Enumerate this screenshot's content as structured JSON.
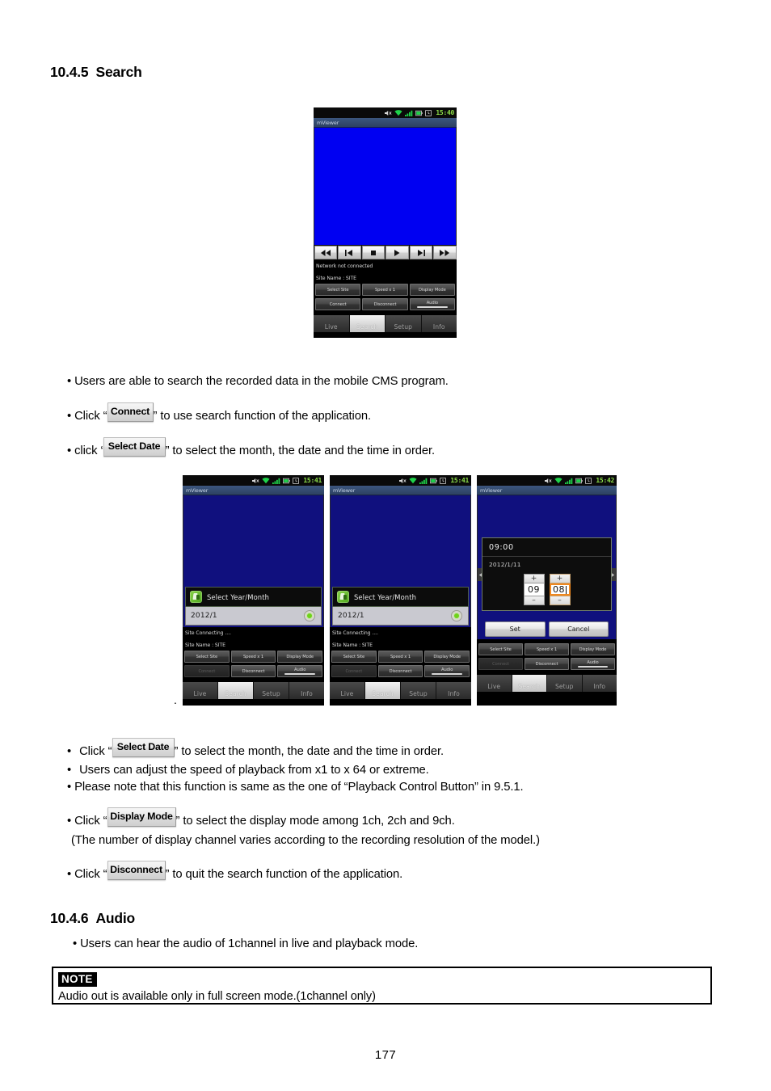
{
  "document": {
    "page_number": "177",
    "sections": [
      {
        "number": "10.4.5",
        "title": "Search"
      },
      {
        "number": "10.4.6",
        "title": "Audio"
      }
    ]
  },
  "search_section": {
    "bullets": {
      "b1": "Users are able to search the recorded data in the mobile CMS program.",
      "b2_pre": "Click “",
      "b2_btn": "Connect",
      "b2_post": "” to use search function of the application.",
      "b3_pre": "click ‘",
      "b3_btn": "Select Date",
      "b3_post": "” to select the month, the date and the time in order.",
      "b4_pre": "Click “",
      "b4_btn": "Select Date",
      "b4_post": "” to select the month, the date and the time in order.",
      "b5": "Users can adjust the speed of playback from x1 to x 64 or extreme.",
      "b6": "Please note that this function is same as the one of “Playback Control Button” in 9.5.1.",
      "b7_pre": "Click “",
      "b7_btn": "Display Mode",
      "b7_post": "” to select the display mode among 1ch, 2ch and 9ch.",
      "b8": "(The number of display channel varies according to the recording resolution of the model.)",
      "b9_pre": "Click “",
      "b9_btn": "Disconnect",
      "b9_post": "” to quit the search function of the application."
    }
  },
  "audio_section": {
    "bullet": "Users can hear the audio of 1channel in live and playback mode.",
    "note_tag": "NOTE",
    "note_text": "Audio out is available only in full screen mode.(1channel only)"
  },
  "phones": {
    "phone1": {
      "status_time": "15:40",
      "app_title": "mViewer",
      "transport_buttons": [
        "rewind-icon",
        "step-back-icon",
        "stop-icon",
        "play-icon",
        "step-forward-icon",
        "fast-forward-icon"
      ],
      "status_line1": "Network not connected",
      "status_line2": "Site Name : SITE",
      "controls_row1": [
        "Select Site",
        "Speed x 1",
        "Display Mode"
      ],
      "controls_row2": [
        "Connect",
        "Disconnect",
        "Audio"
      ],
      "tabs": [
        "Live",
        "Search",
        "Setup",
        "Info"
      ],
      "active_tab": "Search"
    },
    "phone2": {
      "status_time": "15:41",
      "app_title": "mViewer",
      "dialog_title": "Select Year/Month",
      "dialog_value": "2012/1",
      "status_line1": "Site Connecting ....",
      "status_line2": "Site Name : SITE",
      "controls_row1": [
        "Select Site",
        "Speed x 1",
        "Display Mode"
      ],
      "controls_row2": [
        "Connect",
        "Disconnect",
        "Audio"
      ],
      "tabs": [
        "Live",
        "Search",
        "Setup",
        "Info"
      ],
      "active_tab": "Search"
    },
    "phone3": {
      "status_time": "15:41",
      "app_title": "mViewer",
      "dialog_title": "Select Year/Month",
      "dialog_value": "2012/1",
      "status_line1": "Site Connecting ....",
      "status_line2": "Site Name : SITE",
      "controls_row1": [
        "Select Site",
        "Speed x 1",
        "Display Mode"
      ],
      "controls_row2": [
        "Connect",
        "Disconnect",
        "Audio"
      ],
      "tabs": [
        "Live",
        "Search",
        "Setup",
        "Info"
      ],
      "active_tab": "Search"
    },
    "phone4": {
      "status_time": "15:42",
      "app_title": "mViewer",
      "picker_time": "09:00",
      "picker_date": "2012/1/11",
      "spinner_hour": "09",
      "spinner_minute": "08",
      "plus_label": "+",
      "minus_label": "–",
      "set_label": "Set",
      "cancel_label": "Cancel",
      "controls_row1": [
        "Select Site",
        "Speed x 1",
        "Display Mode"
      ],
      "controls_row2": [
        "Connect",
        "Disconnect",
        "Audio"
      ],
      "tabs": [
        "Live",
        "Search",
        "Setup",
        "Info"
      ],
      "active_tab": "Search"
    }
  },
  "colors": {
    "video_blue": "#0000f2",
    "video_blue_dim": "#10107e",
    "status_green": "#8ee04a",
    "focus_orange": "#f0881e",
    "dialog_icon_green": "#4fa81f"
  }
}
